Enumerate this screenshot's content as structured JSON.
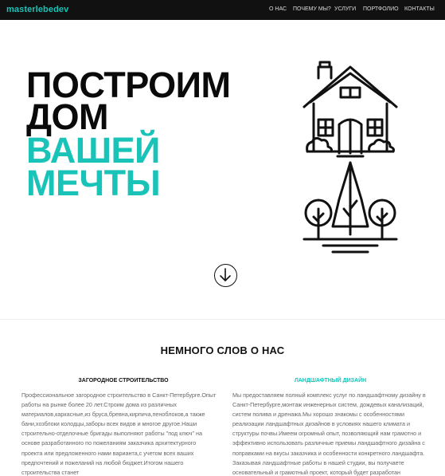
{
  "navbar": {
    "brand": "masterlebedev",
    "items": [
      "О НАС",
      "ПОЧЕМУ МЫ?",
      "УСЛУГИ",
      "ПОРТФОЛИО",
      "КОНТАКТЫ"
    ]
  },
  "hero": {
    "lines": [
      "ПОСТРОИМ",
      "ДОМ",
      "ВАШЕЙ",
      "МЕЧТЫ"
    ],
    "accent_color": "#19c3b8"
  },
  "about": {
    "title": "НЕМНОГО СЛОВ О НАС",
    "columns": [
      {
        "title": "ЗАГОРОДНОЕ СТРОИТЕЛЬСТВО",
        "text": "Профессиональное загородное строительство в Санкт-Петербурге.Опыт работы на рынке более 20 лет.Строим дома из различных материалов,каркасные,из бруса,бревна,кирпича,пеноблоков,а также бани,хозблоки колодцы,заборы всех видов и многое другое.Наши строительно-отделочные бригады выполняют работы \"под ключ\" на основе разработанного по пожеланиям заказчика архитектурного проекта или предложенного нами варианта,с учетом всех ваших предпочтений и пожеланий на любой бюджет.Итогом нашего строительства станет"
      },
      {
        "title": "ЛАНДШАФТНЫЙ ДИЗАЙН",
        "text": "Мы предоставляем полный комплекс услуг по ландшафтному дизайну в Санкт-Петербурге,монтаж инженерных систем, дождевых канализаций, систем полива и дренажа.Мы хорошо знакомы с особенностями реализации ландшафтных дизайнов в условиях нашего климата и структуры почвы.Имеем огромный опыт, позволяющий нам грамотно и эффективно использовать различные приемы ландшафтного дизайна с поправками на вкусы заказчика и особенности конкретного ландшафта. Заказывая ландшафтные работы в нашей студии, вы получаете основательный и грамотный проект, который будет разработан"
      }
    ]
  }
}
